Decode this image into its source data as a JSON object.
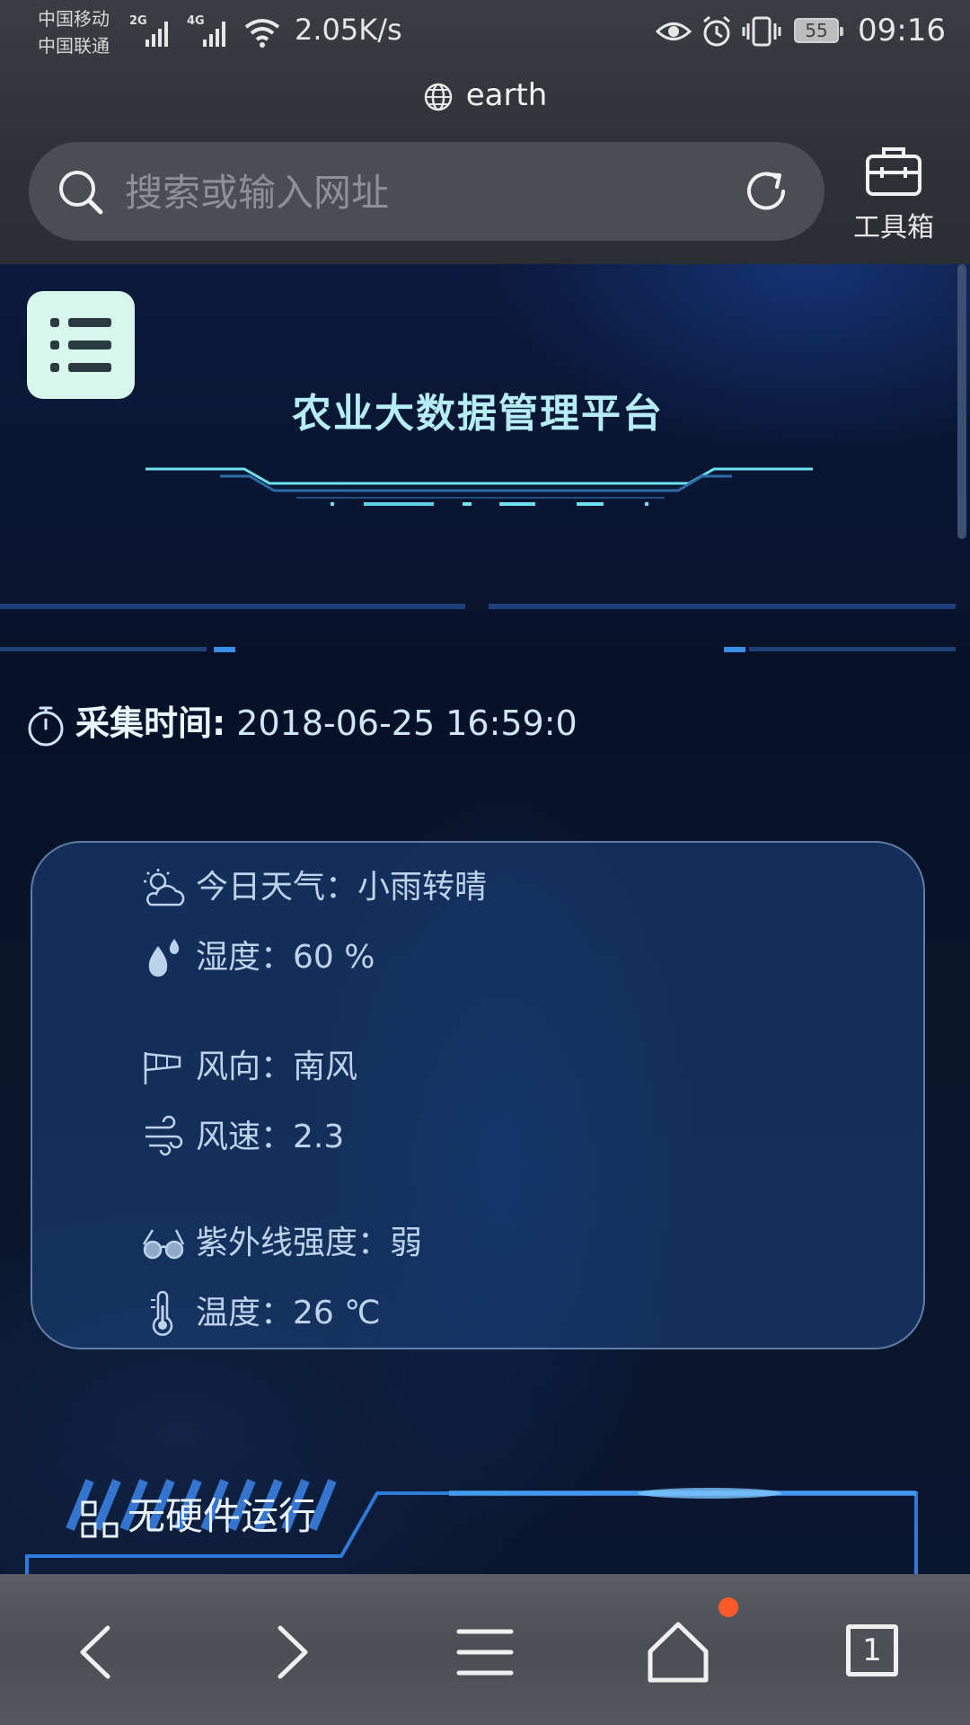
{
  "status_bar": {
    "carrier_1": "中国移动",
    "carrier_2": "中国联通",
    "net_1": "2G",
    "net_2": "4G",
    "net_speed": "2.05K/s",
    "battery": "55",
    "time": "09:16"
  },
  "browser": {
    "page_title": "earth",
    "search_placeholder": "搜索或输入网址",
    "toolbox_label": "工具箱",
    "tab_count": "1"
  },
  "page": {
    "title": "农业大数据管理平台",
    "collect_time_label": "采集时间:",
    "collect_time_value": "2018-06-25 16:59:0",
    "weather": {
      "today_label": "今日天气：",
      "today_value": "小雨转晴",
      "humidity_label": "湿度：",
      "humidity_value": "60 %",
      "wind_dir_label": "风向：",
      "wind_dir_value": "南风",
      "wind_speed_label": "风速：",
      "wind_speed_value": "2.3",
      "uv_label": "紫外线强度：",
      "uv_value": "弱",
      "temp_label": "温度：",
      "temp_value": "26 ℃"
    },
    "hardware_label": "无硬件运行"
  },
  "colors": {
    "accent_cyan": "#6fe0f0",
    "menu_button_bg": "#d8f7ec",
    "notification_dot": "#ff5a2a"
  }
}
